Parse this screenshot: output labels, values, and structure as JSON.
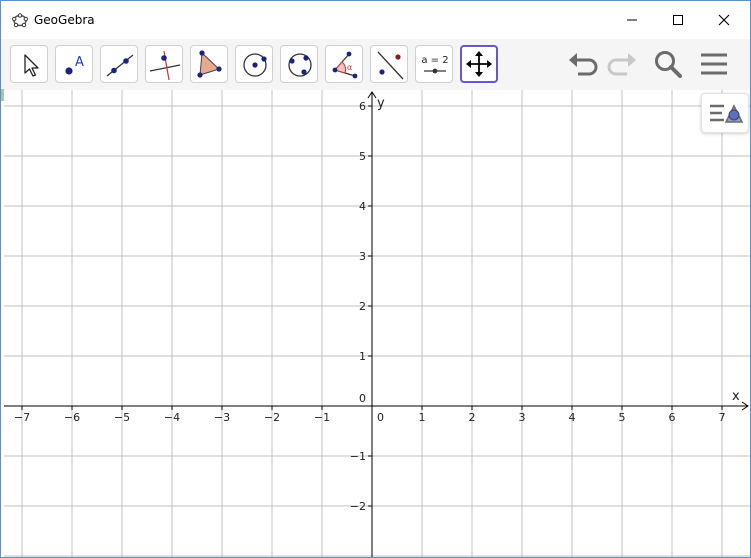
{
  "window": {
    "title": "GeoGebra",
    "app_icon": "geogebra-logo-icon",
    "controls": [
      "minimize-icon",
      "maximize-icon",
      "close-icon"
    ]
  },
  "toolbar": {
    "tools": [
      {
        "name": "move-tool",
        "icon": "arrow-cursor-icon",
        "active": false
      },
      {
        "name": "point-tool",
        "icon": "point-a-icon",
        "active": false
      },
      {
        "name": "line-tool",
        "icon": "line-through-points-icon",
        "active": false
      },
      {
        "name": "perpendicular-line-tool",
        "icon": "perpendicular-line-icon",
        "active": false
      },
      {
        "name": "polygon-tool",
        "icon": "polygon-icon",
        "active": false
      },
      {
        "name": "circle-center-point-tool",
        "icon": "circle-center-point-icon",
        "active": false
      },
      {
        "name": "circle-three-points-tool",
        "icon": "circle-three-points-icon",
        "active": false
      },
      {
        "name": "angle-tool",
        "icon": "angle-icon",
        "active": false
      },
      {
        "name": "reflect-about-line-tool",
        "icon": "reflect-line-icon",
        "active": false
      },
      {
        "name": "slider-tool",
        "icon": "slider-icon",
        "label": "a = 2",
        "active": false
      },
      {
        "name": "move-graphics-view-tool",
        "icon": "move-arrows-icon",
        "active": true
      }
    ],
    "right_buttons": [
      "undo-icon",
      "redo-icon",
      "search-icon",
      "menu-icon"
    ],
    "redo_enabled": false
  },
  "graphics": {
    "x_label": "x",
    "y_label": "y",
    "x_ticks": [
      "−7",
      "−6",
      "−5",
      "−4",
      "−3",
      "−2",
      "−1",
      "0",
      "1",
      "2",
      "3",
      "4",
      "5",
      "6",
      "7"
    ],
    "y_ticks_positive": [
      "6",
      "5",
      "4",
      "3",
      "2",
      "1"
    ],
    "origin_y_label": "0",
    "y_ticks_negative": [
      "−1",
      "−2"
    ],
    "grid": true,
    "style_bar_icon": "graphics-style-bar-icon"
  },
  "colors": {
    "accent": "#6557d2",
    "grid": "#c0c0c0",
    "axes": "#000000",
    "point": "#1a237e",
    "polygon_fill": "#e8a890",
    "angle": "#d32f2f"
  }
}
